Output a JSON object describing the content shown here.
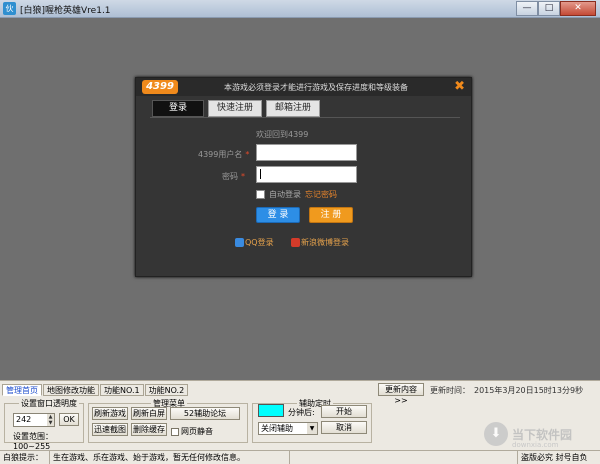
{
  "window": {
    "title": "[白狼]喔枪英雄Vre1.1",
    "app_icon": "伙",
    "minimize": "—",
    "maximize": "□",
    "close": "✕"
  },
  "dialog": {
    "logo": "4399",
    "notice": "本游戏必须登录才能进行游戏及保存进度和等级装备",
    "close": "✖",
    "tabs": [
      "登录",
      "快速注册",
      "邮箱注册"
    ],
    "welcome": "欢迎回到4399",
    "username_label": "4399用户名",
    "password_label": "密码",
    "required_mark": "*",
    "username_value": "",
    "password_value": "",
    "auto_login": "自动登录",
    "forgot_password": "忘记密码",
    "login_button": "登 录",
    "register_button": "注 册",
    "qq_login": "QQ登录",
    "weibo_login": "新浪微博登录"
  },
  "panel": {
    "tabs": [
      "管理首页",
      "地图修改功能",
      "功能NO.1",
      "功能NO.2"
    ],
    "more_button": "更新内容>>",
    "update_label": "更新时间：",
    "update_time": "2015年3月20日15时13分9秒",
    "transparency": {
      "label": "设置窗口透明度",
      "value": "242",
      "ok": "OK",
      "range": "设置范围：100~255"
    },
    "menu": {
      "label": "管理菜单",
      "buttons": [
        "刷新游戏",
        "刷新白屏",
        "52辅助论坛",
        "迅速截图",
        "删除缓存"
      ],
      "mute": "网页静音"
    },
    "timer": {
      "label": "辅助定时",
      "minutes_after": "分钟后:",
      "start": "开始",
      "cancel": "取消",
      "select_value": "关闭辅助",
      "color": "#00ffff"
    }
  },
  "watermark": {
    "text": "当下软件园",
    "sub": "downxia.com"
  },
  "status": {
    "cells": [
      "白狼提示：",
      "生在游戏、乐在游戏、始于游戏，暂无任何修改信息。",
      "",
      "盗版必究 封号自负"
    ]
  }
}
